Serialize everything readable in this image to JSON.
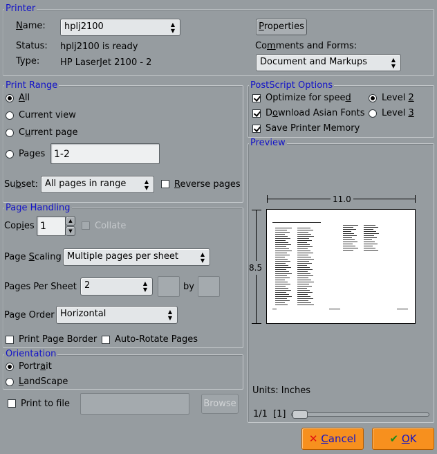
{
  "printer": {
    "group_title": "Printer",
    "name_label_pre": "",
    "name_label_u": "N",
    "name_label_post": "ame:",
    "name_value": "hplj2100",
    "status_label": "Status:",
    "status_value": "hplj2100 is ready",
    "type_label": "Type:",
    "type_value": "HP LaserJet 2100 -  2",
    "properties_u": "P",
    "properties_rest": "roperties",
    "comments_label_pre": "Co",
    "comments_label_u": "m",
    "comments_label_post": "ments and Forms:",
    "comments_value": "Document and Markups"
  },
  "print_range": {
    "group_title": "Print Range",
    "all_u": "A",
    "all_rest": "ll",
    "current_view": "Current view",
    "current_page_pre": "C",
    "current_page_u": "u",
    "current_page_post": "rrent page",
    "pages": "Pages",
    "pages_value": "1-2",
    "subset_pre": "Su",
    "subset_u": "b",
    "subset_post": "set:",
    "subset_value": "All pages in range",
    "reverse_pre": "",
    "reverse_u": "R",
    "reverse_post": "everse pages"
  },
  "postscript": {
    "group_title": "PostScript Options",
    "optimize": "Optimize for spee",
    "optimize_u": "d",
    "download_pre": "D",
    "download_u": "o",
    "download_post": "wnload Asian Fonts",
    "save_memory": "Save Printer Memory",
    "level2_pre": "Level ",
    "level2_u": "2",
    "level3_pre": "Level ",
    "level3_u": "3"
  },
  "preview": {
    "group_title": "Preview",
    "width_label": "11.0",
    "height_label": "8.5",
    "units": "Units: Inches",
    "page_counter": "1/1",
    "page_index": "[1]"
  },
  "page_handling": {
    "group_title": "Page Handling",
    "copies_pre": "Cop",
    "copies_u": "i",
    "copies_post": "es",
    "copies_value": "1",
    "collate": "Collate",
    "page_scaling_pre": "Page ",
    "page_scaling_u": "S",
    "page_scaling_post": "caling",
    "page_scaling_value": "Multiple pages per sheet",
    "pages_per_sheet": "Pages Per Sheet",
    "pages_per_sheet_value": "2",
    "by": "by",
    "page_order": "Page Order",
    "page_order_value": "Horizontal",
    "print_page_border": "Print Page Border",
    "auto_rotate": "Auto-Rotate Pages"
  },
  "orientation": {
    "group_title": "Orientation",
    "portrait_pre": "Portr",
    "portrait_u": "a",
    "portrait_post": "it",
    "landscape_pre": "",
    "landscape_u": "L",
    "landscape_post": "andScape"
  },
  "print_to_file": "Print to file",
  "browse": "Browse",
  "cancel": "Cancel",
  "cancel_u": "C",
  "cancel_rest": "ancel",
  "ok_u": "O",
  "ok_rest": "K",
  "colors": {
    "background": "#969ca0",
    "group_title": "#1212c8",
    "accent_button": "#f7901e"
  }
}
